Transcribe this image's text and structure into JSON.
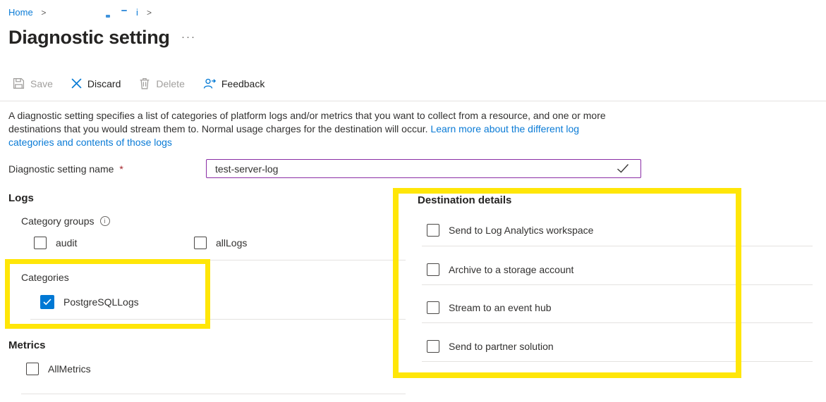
{
  "breadcrumb": {
    "home": "Home",
    "separator": ">",
    "redacted_fragment": "i"
  },
  "header": {
    "title": "Diagnostic setting",
    "more_label": "···"
  },
  "toolbar": {
    "save": "Save",
    "discard": "Discard",
    "delete": "Delete",
    "feedback": "Feedback"
  },
  "description": {
    "line1": "A diagnostic setting specifies a list of categories of platform logs and/or metrics that you want to collect from a resource, and one or more",
    "line2_plain": "destinations that you would stream them to. Normal usage charges for the destination will occur. ",
    "line2_link": "Learn more about the different log",
    "line3_link": "categories and contents of those logs"
  },
  "name_field": {
    "label": "Diagnostic setting name",
    "required_marker": "*",
    "value": "test-server-log"
  },
  "logs": {
    "heading": "Logs",
    "category_groups_label": "Category groups",
    "info_icon_glyph": "i",
    "groups": [
      {
        "label": "audit",
        "checked": false
      },
      {
        "label": "allLogs",
        "checked": false
      }
    ],
    "categories_label": "Categories",
    "categories": [
      {
        "label": "PostgreSQLLogs",
        "checked": true
      }
    ]
  },
  "metrics": {
    "heading": "Metrics",
    "items": [
      {
        "label": "AllMetrics",
        "checked": false
      }
    ]
  },
  "destination": {
    "heading": "Destination details",
    "options": [
      {
        "label": "Send to Log Analytics workspace",
        "checked": false
      },
      {
        "label": "Archive to a storage account",
        "checked": false
      },
      {
        "label": "Stream to an event hub",
        "checked": false
      },
      {
        "label": "Send to partner solution",
        "checked": false
      }
    ]
  },
  "colors": {
    "accent_blue": "#0078d4",
    "highlight_yellow": "#ffe608",
    "input_border_purple": "#8a2da5",
    "required_red": "#a4262c",
    "disabled_gray": "#a19f9d"
  }
}
